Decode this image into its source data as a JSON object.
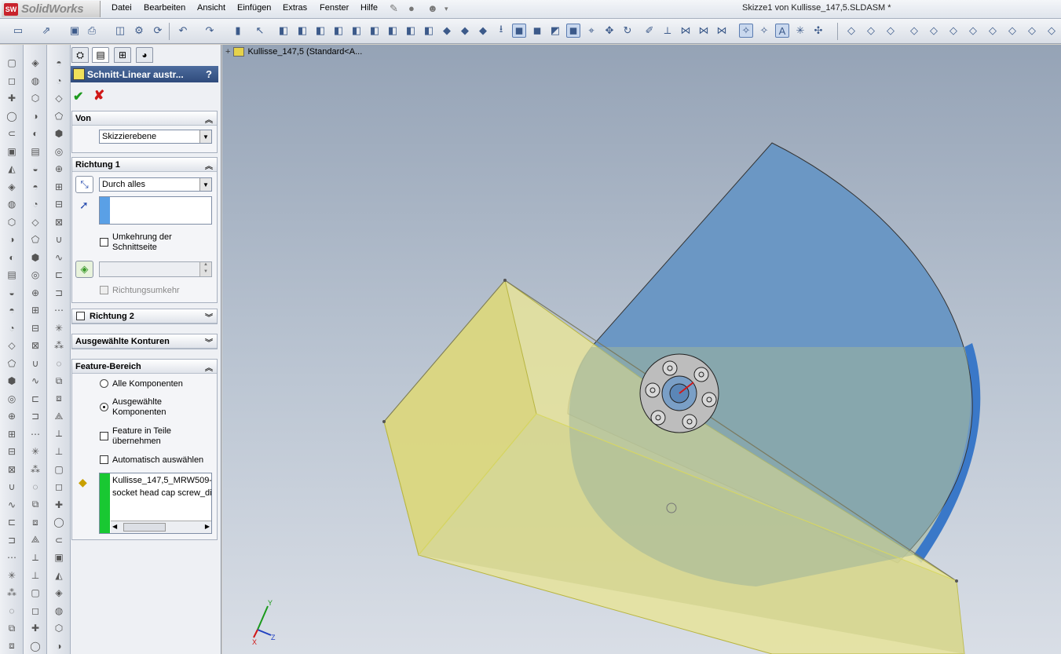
{
  "app": {
    "name": "SolidWorks",
    "logo_text": "SW"
  },
  "menu": [
    "Datei",
    "Bearbeiten",
    "Ansicht",
    "Einfügen",
    "Extras",
    "Fenster",
    "Hilfe"
  ],
  "window_title": "Skizze1 von Kullisse_147,5.SLDASM *",
  "tree": {
    "root": "Kullisse_147,5  (Standard<A..."
  },
  "pm": {
    "title": "Schnitt-Linear austr...",
    "help": "?",
    "ok": "✔",
    "cancel": "✘",
    "von": {
      "header": "Von",
      "value": "Skizzierebene"
    },
    "richtung1": {
      "header": "Richtung 1",
      "end_condition": "Durch alles",
      "flip_side": "Umkehrung der\nSchnittseite",
      "direction_reverse": "Richtungsumkehr"
    },
    "richtung2": {
      "header": "Richtung 2"
    },
    "konturen": {
      "header": "Ausgewählte Konturen"
    },
    "feature_bereich": {
      "header": "Feature-Bereich",
      "opt_all": "Alle Komponenten",
      "opt_selected": "Ausgewählte\nKomponenten",
      "propagate": "Feature in Teile\nübernehmen",
      "auto_select": "Automatisch auswählen",
      "list": [
        "Kullisse_147,5_MRW509-:",
        "socket head cap screw_di"
      ]
    }
  },
  "colors": {
    "accent_title": "#2f4b7c",
    "part_yellow": "#d8d890",
    "disk_blue": "#6f9ac6",
    "ok_green": "#1f9a1f",
    "cancel_red": "#d01818"
  }
}
